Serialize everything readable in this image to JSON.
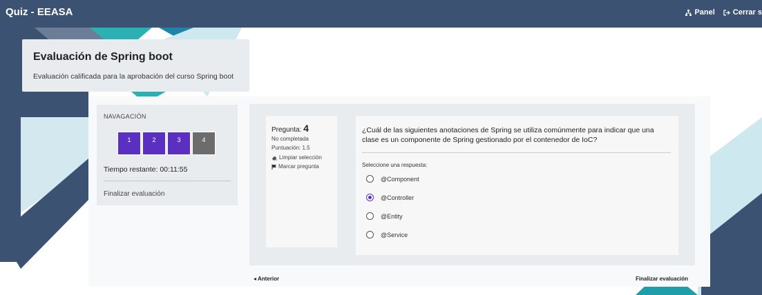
{
  "app": {
    "title": "Quiz - EEASA"
  },
  "topnav": {
    "panel_label": "Panel",
    "logout_label": "Cerrar s"
  },
  "header": {
    "title": "Evaluación de Spring boot",
    "subtitle": "Evaluación calificada para la aprobación del curso Spring boot"
  },
  "navigation": {
    "title": "NAVAGACIÓN",
    "questions": [
      {
        "label": "1",
        "state": "done"
      },
      {
        "label": "2",
        "state": "done"
      },
      {
        "label": "3",
        "state": "done"
      },
      {
        "label": "4",
        "state": "current"
      }
    ],
    "timer": "Tiempo restante: 00:11:55",
    "finish_link": "Finalizar evaluación"
  },
  "question_info": {
    "prefix": "Pregunta: ",
    "number": "4",
    "status": "No completada",
    "score": "Puntuación: 1.5",
    "clear_label": "Limpiar selección",
    "flag_label": "Marcar pregunta"
  },
  "question": {
    "text": "¿Cuál de las siguientes anotaciones de Spring se utiliza comúnmente para indicar que una clase es un componente de Spring gestionado por el contenedor de IoC?",
    "prompt": "Seleccione una respuesta:",
    "options": [
      "@Component",
      "@Controller",
      "@Entity",
      "@Service"
    ],
    "selected": 1
  },
  "footer": {
    "prev_label": "Anterior",
    "finish_label": "Finalizar evaluación"
  },
  "colors": {
    "navy": "#3c5272",
    "teal": "#1f9eaa",
    "purple": "#5a2fc1"
  }
}
